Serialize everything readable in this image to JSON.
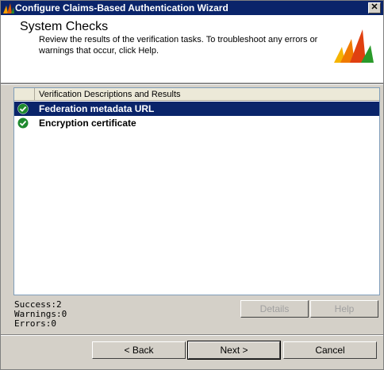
{
  "window": {
    "title": "Configure Claims-Based Authentication Wizard"
  },
  "header": {
    "title": "System Checks",
    "description": "Review the results of the verification tasks. To troubleshoot any errors or warnings that occur, click Help."
  },
  "grid": {
    "column_header": "Verification Descriptions and Results",
    "rows": [
      {
        "label": "Federation metadata URL",
        "status_icon": "check-circle-icon",
        "selected": true
      },
      {
        "label": "Encryption certificate",
        "status_icon": "check-circle-icon",
        "selected": false
      }
    ]
  },
  "summary": {
    "success": "Success:2",
    "warnings": "Warnings:0",
    "errors": "Errors:0"
  },
  "buttons": {
    "details": "Details",
    "help": "Help",
    "back": "< Back",
    "next": "Next >",
    "cancel": "Cancel"
  },
  "colors": {
    "title_bar": "#0a246a",
    "selection": "#0a246a",
    "success_green": "#2a9a2a"
  }
}
